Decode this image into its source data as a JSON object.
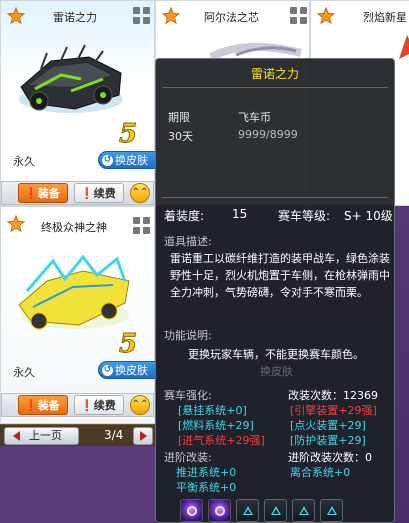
{
  "cards": [
    {
      "title": "雷诺之力",
      "duration": "永久",
      "skin_label": "换皮肤",
      "grade": "5",
      "equip_label": "装备",
      "renew_label": "续费",
      "upgrade_glyph": "⌃⌃"
    },
    {
      "title": "阿尔法之芯"
    },
    {
      "title": "烈焰新星"
    },
    {
      "title": "终极众神之神",
      "duration": "永久",
      "skin_label": "换皮肤",
      "grade": "5",
      "equip_label": "装备",
      "renew_label": "续费",
      "upgrade_glyph": "⌃⌃"
    }
  ],
  "pager": {
    "prev_label": "上一页",
    "page_text": "3/4"
  },
  "tooltip": {
    "title": "雷诺之力",
    "term_header": "期限",
    "currency_header": "飞车币",
    "term_value": "30天",
    "currency_value": "9999/8999",
    "equip_level_label": "着装度:",
    "equip_level_value": "15",
    "car_level_label": "赛车等级:",
    "car_level_value": "S+ 10级",
    "desc_label": "道具描述:",
    "desc_text": "雷诺重工以碳纤维打造的装甲战车，绿色涂装野性十足，烈火机炮置于车侧，在枪林弹雨中全力冲刺，气势磅礴，令对手不寒而栗。",
    "func_label": "功能说明:",
    "func_text": "更换玩家车辆，不能更换赛车颜色。",
    "ghost_text": "换皮肤",
    "strengthen_label": "赛车强化:",
    "modify_count": "改装次数：12369",
    "slots": [
      {
        "text": "[悬挂系统+0]",
        "color": "cyan"
      },
      {
        "text": "[引擎装置+29强]",
        "color": "red"
      },
      {
        "text": "[燃料系统+29]",
        "color": "cyan"
      },
      {
        "text": "[点火装置+29]",
        "color": "cyan"
      },
      {
        "text": "[进气系统+29强]",
        "color": "red"
      },
      {
        "text": "[防护装置+29]",
        "color": "cyan"
      }
    ],
    "advanced_label": "进阶改装:",
    "advanced_count": "进阶改装次数：0",
    "advanced_items": [
      {
        "text": "推进系统+0"
      },
      {
        "text": "离合系统+0"
      },
      {
        "text": "平衡系统+0"
      }
    ]
  },
  "colors": {
    "accent_orange": "#e86a0c",
    "skin_blue": "#1e6cc2",
    "title_yellow": "#ffe21a",
    "cyan": "#3fd7e8",
    "red": "#ff3a3a"
  }
}
